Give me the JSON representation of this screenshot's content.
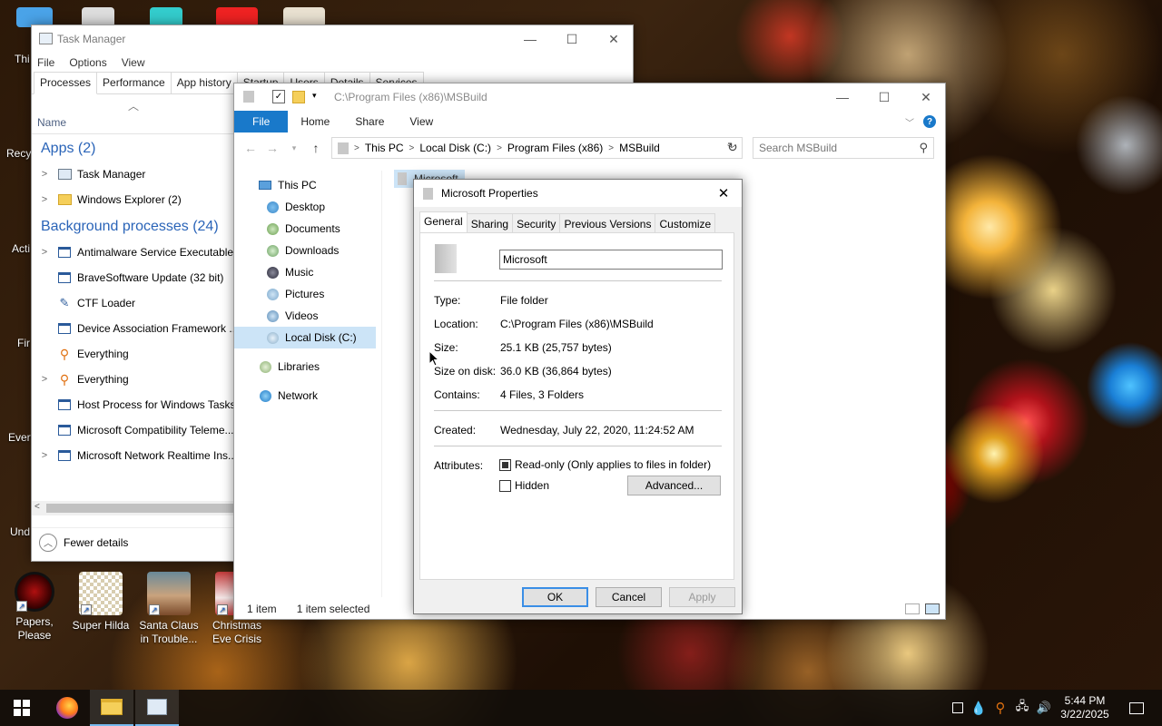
{
  "desktop": {
    "icons": [
      {
        "label": "Papers,\nPlease"
      },
      {
        "label": "Super Hilda"
      },
      {
        "label": "Santa Claus\nin Trouble..."
      },
      {
        "label": "Christmas\nEve Crisis"
      }
    ],
    "edge_labels": [
      "Thi",
      "Recy",
      "Acti",
      "Fir",
      "Every",
      "Und"
    ]
  },
  "task_manager": {
    "title": "Task Manager",
    "menu": [
      "File",
      "Options",
      "View"
    ],
    "tabs": [
      "Processes",
      "Performance",
      "App history",
      "Startup",
      "Users",
      "Details",
      "Services"
    ],
    "active_tab": "Processes",
    "column_header": "Name",
    "groups": {
      "apps": "Apps (2)",
      "background": "Background processes (24)"
    },
    "apps": [
      {
        "name": "Task Manager",
        "icon": "task-manager-icon",
        "expandable": true
      },
      {
        "name": "Windows Explorer (2)",
        "icon": "folder-icon",
        "expandable": true
      }
    ],
    "background": [
      {
        "name": "Antimalware Service Executable",
        "icon": "window-app-icon",
        "expandable": true
      },
      {
        "name": "BraveSoftware Update (32 bit)",
        "icon": "update-icon",
        "expandable": false
      },
      {
        "name": "CTF Loader",
        "icon": "pen-icon",
        "expandable": false
      },
      {
        "name": "Device Association Framework ...",
        "icon": "window-app-icon",
        "expandable": false
      },
      {
        "name": "Everything",
        "icon": "magnifier-icon",
        "expandable": false
      },
      {
        "name": "Everything",
        "icon": "magnifier-icon",
        "expandable": true
      },
      {
        "name": "Host Process for Windows Tasks",
        "icon": "window-app-icon",
        "expandable": false
      },
      {
        "name": "Microsoft Compatibility Teleme...",
        "icon": "window-app-icon",
        "expandable": false
      },
      {
        "name": "Microsoft Network Realtime Ins...",
        "icon": "window-app-icon",
        "expandable": true
      }
    ],
    "footer": "Fewer details"
  },
  "explorer": {
    "title": "C:\\Program Files (x86)\\MSBuild",
    "ribbon_tabs": [
      "File",
      "Home",
      "Share",
      "View"
    ],
    "breadcrumb": [
      "This PC",
      "Local Disk (C:)",
      "Program Files (x86)",
      "MSBuild"
    ],
    "search_placeholder": "Search MSBuild",
    "nav": [
      {
        "label": "This PC",
        "icon": "this-pc-icon",
        "indent": 0
      },
      {
        "label": "Desktop",
        "icon": "desktop-icon",
        "indent": 1
      },
      {
        "label": "Documents",
        "icon": "documents-icon",
        "indent": 1
      },
      {
        "label": "Downloads",
        "icon": "downloads-icon",
        "indent": 1
      },
      {
        "label": "Music",
        "icon": "music-icon",
        "indent": 1
      },
      {
        "label": "Pictures",
        "icon": "pictures-icon",
        "indent": 1
      },
      {
        "label": "Videos",
        "icon": "videos-icon",
        "indent": 1
      },
      {
        "label": "Local Disk (C:)",
        "icon": "drive-icon",
        "indent": 1,
        "selected": true
      },
      {
        "label": "Libraries",
        "icon": "libraries-icon",
        "indent": 0
      },
      {
        "label": "Network",
        "icon": "network-icon",
        "indent": 0
      }
    ],
    "file_item": "Microsoft",
    "status": {
      "count": "1 item",
      "selected": "1 item selected"
    }
  },
  "properties": {
    "title": "Microsoft Properties",
    "tabs": [
      "General",
      "Sharing",
      "Security",
      "Previous Versions",
      "Customize"
    ],
    "name_value": "Microsoft",
    "rows": {
      "type": {
        "label": "Type:",
        "value": "File folder"
      },
      "location": {
        "label": "Location:",
        "value": "C:\\Program Files (x86)\\MSBuild"
      },
      "size": {
        "label": "Size:",
        "value": "25.1 KB (25,757 bytes)"
      },
      "size_on_disk": {
        "label": "Size on disk:",
        "value": "36.0 KB (36,864 bytes)"
      },
      "contains": {
        "label": "Contains:",
        "value": "4 Files, 3 Folders"
      },
      "created": {
        "label": "Created:",
        "value": "Wednesday, July 22, 2020, 11:24:52 AM"
      }
    },
    "attributes_label": "Attributes:",
    "readonly_label": "Read-only (Only applies to files in folder)",
    "hidden_label": "Hidden",
    "advanced_label": "Advanced...",
    "ok": "OK",
    "cancel": "Cancel",
    "apply": "Apply"
  },
  "taskbar": {
    "time": "5:44 PM",
    "date": "3/22/2025"
  },
  "colors": {
    "accent": "#1979ca",
    "selection": "#cce4f7",
    "group_text": "#2a64b8"
  }
}
